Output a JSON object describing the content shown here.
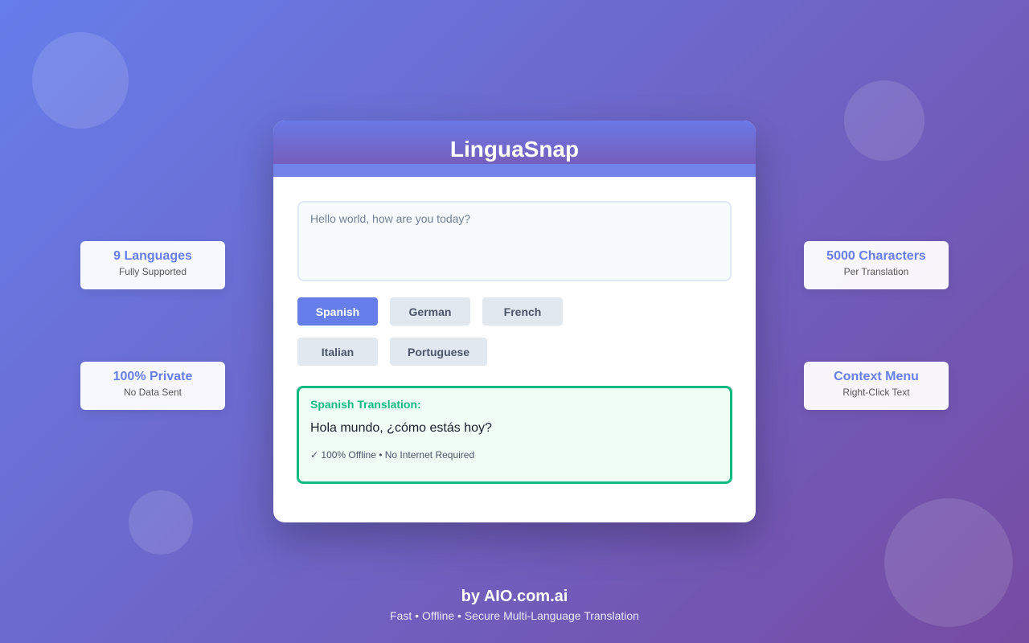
{
  "app": {
    "title": "LinguaSnap"
  },
  "input": {
    "placeholder": "Hello world, how are you today?"
  },
  "languages": [
    {
      "label": "Spanish",
      "active": true
    },
    {
      "label": "German",
      "active": false
    },
    {
      "label": "French",
      "active": false
    },
    {
      "label": "Italian",
      "active": false
    },
    {
      "label": "Portuguese",
      "active": false
    }
  ],
  "result": {
    "heading": "Spanish Translation:",
    "text": "Hola mundo, ¿cómo estás hoy?",
    "note": "✓ 100% Offline • No Internet Required"
  },
  "stats": [
    {
      "value": "9 Languages",
      "label": "Fully Supported"
    },
    {
      "value": "100% Private",
      "label": "No Data Sent"
    },
    {
      "value": "5000 Characters",
      "label": "Per Translation"
    },
    {
      "value": "Context Menu",
      "label": "Right-Click Text"
    }
  ],
  "footer": {
    "brand": "by AIO.com.ai",
    "tagline": "Fast • Offline • Secure Multi-Language Translation"
  },
  "colors": {
    "accent": "#667eea",
    "gradient_end": "#764ba2",
    "success": "#10b981"
  }
}
